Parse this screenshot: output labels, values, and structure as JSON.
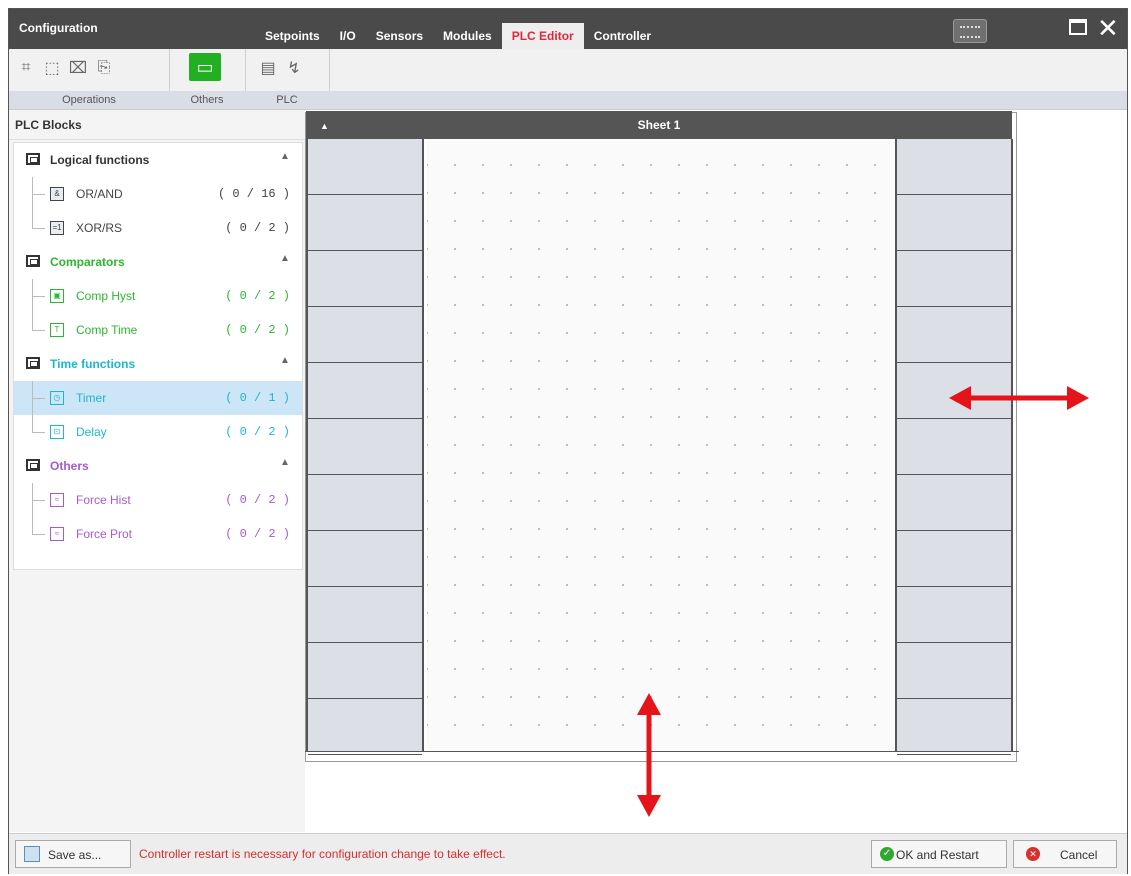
{
  "window": {
    "title": "Configuration",
    "tabs": [
      {
        "label": "Setpoints",
        "active": false
      },
      {
        "label": "I/O",
        "active": false
      },
      {
        "label": "Sensors",
        "active": false
      },
      {
        "label": "Modules",
        "active": false
      },
      {
        "label": "PLC Editor",
        "active": true
      },
      {
        "label": "Controller",
        "active": false
      }
    ],
    "accent_color": "#e0283c"
  },
  "toolbar": {
    "groups": [
      {
        "label": "Operations",
        "icons": [
          "select-block-icon",
          "frame-icon",
          "unselect-icon",
          "export-icon"
        ]
      },
      {
        "label": "Others",
        "icons": [
          "comment-icon"
        ]
      },
      {
        "label": "PLC",
        "icons": [
          "sheet-icon",
          "plc-icon"
        ]
      }
    ]
  },
  "left_panel": {
    "title": "PLC Blocks",
    "categories": [
      {
        "label": "Logical functions",
        "color": "#333333",
        "items": [
          {
            "label": "OR/AND",
            "count": "( 0 / 16 )",
            "icon": "or-and-icon"
          },
          {
            "label": "XOR/RS",
            "count": "( 0 / 2 )",
            "icon": "xor-rs-icon"
          }
        ]
      },
      {
        "label": "Comparators",
        "color": "#2fb52f",
        "items": [
          {
            "label": "Comp Hyst",
            "count": "( 0 / 2 )",
            "icon": "comp-hyst-icon"
          },
          {
            "label": "Comp Time",
            "count": "( 0 / 2 )",
            "icon": "comp-time-icon"
          }
        ]
      },
      {
        "label": "Time functions",
        "color": "#1fb7c8",
        "items": [
          {
            "label": "Timer",
            "count": "( 0 / 1 )",
            "icon": "timer-icon",
            "selected": true
          },
          {
            "label": "Delay",
            "count": "( 0 / 2 )",
            "icon": "delay-icon"
          }
        ]
      },
      {
        "label": "Others",
        "color": "#a45cc8",
        "items": [
          {
            "label": "Force Hist",
            "count": "( 0 / 2 )",
            "icon": "force-hist-icon"
          },
          {
            "label": "Force Prot",
            "count": "( 0 / 2 )",
            "icon": "force-prot-icon"
          }
        ]
      }
    ]
  },
  "sheet": {
    "title": "Sheet 1",
    "input_cells": 11,
    "output_cells": 11
  },
  "annotations": {
    "arrow_color": "#e5141b"
  },
  "bottom_bar": {
    "save_label": "Save as...",
    "notice": "Controller restart is necessary for configuration change to take effect.",
    "ok_label": "OK and Restart",
    "cancel_label": "Cancel"
  }
}
